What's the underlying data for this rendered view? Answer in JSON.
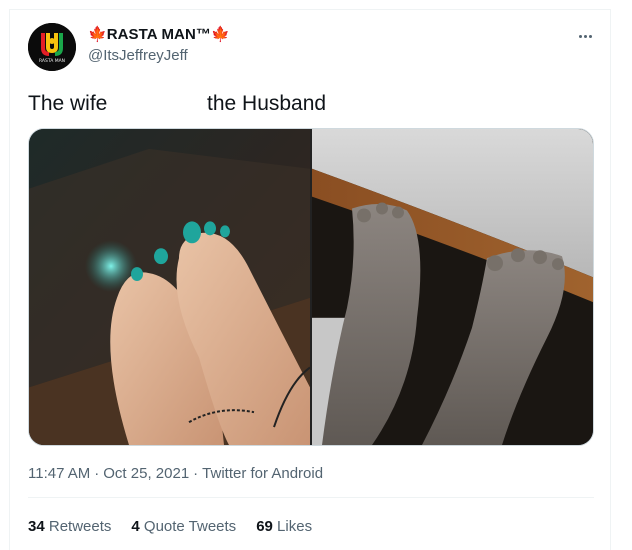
{
  "author": {
    "flag_left": "🍁",
    "display_name": "RASTA MAN™",
    "flag_right": "🍁",
    "handle": "@ItsJeffreyJeff",
    "avatar_text": "RASTA MAN"
  },
  "tweet": {
    "text_left": "The wife",
    "text_right": "the Husband"
  },
  "media": {
    "photo_left_label": "wife feet photo",
    "photo_right_label": "husband feet photo"
  },
  "meta": {
    "time": "11:47 AM",
    "sep1": "·",
    "date": "Oct 25, 2021",
    "sep2": "·",
    "source": "Twitter for Android"
  },
  "stats": {
    "retweets_count": "34",
    "retweets_label": "Retweets",
    "quotes_count": "4",
    "quotes_label": "Quote Tweets",
    "likes_count": "69",
    "likes_label": "Likes"
  },
  "colors": {
    "text_primary": "#0f1419",
    "text_secondary": "#536471",
    "maple": "#d7141a"
  }
}
